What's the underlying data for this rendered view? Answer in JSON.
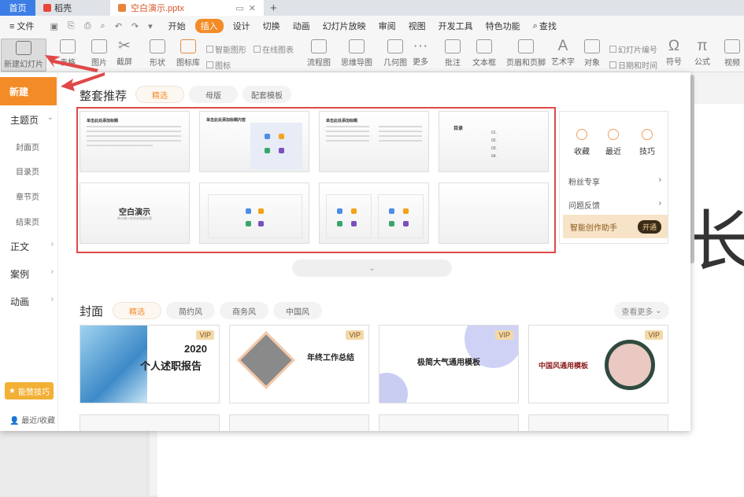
{
  "tabs": {
    "home": "首页",
    "docer": "稻壳",
    "file": "空白演示.pptx",
    "new_tab": "+"
  },
  "menu": {
    "file": "≡ 文件",
    "items": [
      "开始",
      "插入",
      "设计",
      "切换",
      "动画",
      "幻灯片放映",
      "审阅",
      "视图",
      "开发工具",
      "特色功能"
    ],
    "active": "插入",
    "search": "查找"
  },
  "ribbon": {
    "new_slide": "新建幻灯片",
    "table": "表格",
    "picture": "图片",
    "screenshot": "截屏",
    "shape": "形状",
    "icon_lib": "图标库",
    "icon": "图标",
    "smart_graphic": "智能图形",
    "online_chart": "在线图表",
    "flowchart": "流程图",
    "mindmap": "思维导图",
    "geometry": "几何图",
    "more": "更多",
    "comment": "批注",
    "textbox": "文本框",
    "header_footer": "页眉和页脚",
    "wordart": "艺术字",
    "object": "对象",
    "slide_number": "幻灯片编号",
    "datetime": "日期和时间",
    "symbol": "符号",
    "formula": "公式",
    "video": "视频"
  },
  "sidebar": {
    "new": "新建",
    "theme_page": "主题页",
    "cover": "封面页",
    "toc": "目录页",
    "chapter": "章节页",
    "ending": "结束页",
    "body": "正文",
    "case": "案例",
    "animation": "动画",
    "tips": "能赞技巧",
    "recent": "最近/收藏"
  },
  "section1": {
    "title": "整套推荐",
    "chips": [
      "精选",
      "母版",
      "配套模板"
    ],
    "thumbs": {
      "t1": "单击此处添加标题",
      "t2": "单击此处添加标题内容",
      "t3": "单击此处添加标题",
      "t4": "目录",
      "t5": "空白演示",
      "t5_sub": "单击输入你的封面副标题"
    }
  },
  "side_card": {
    "fav": "收藏",
    "recent": "最近",
    "tips": "技巧",
    "fans": "粉丝专享",
    "feedback": "问题反馈",
    "ai": "智能创作助手",
    "ai_btn": "开通"
  },
  "section2": {
    "title": "封面",
    "chips": [
      "精选",
      "简约风",
      "商务风",
      "中国风"
    ],
    "view_more": "查看更多",
    "vip": "VIP",
    "cards": {
      "c1_year": "2020",
      "c1_title": "个人述职报告",
      "c2_title": "年终工作总结",
      "c3_title": "极简大气通用模板",
      "c4_title": "中国风通用模板"
    }
  },
  "background": {
    "big_char": "长"
  },
  "colors": {
    "accent": "#f38b27",
    "home_tab": "#3d7ee6",
    "highlight_box": "#e04848"
  }
}
